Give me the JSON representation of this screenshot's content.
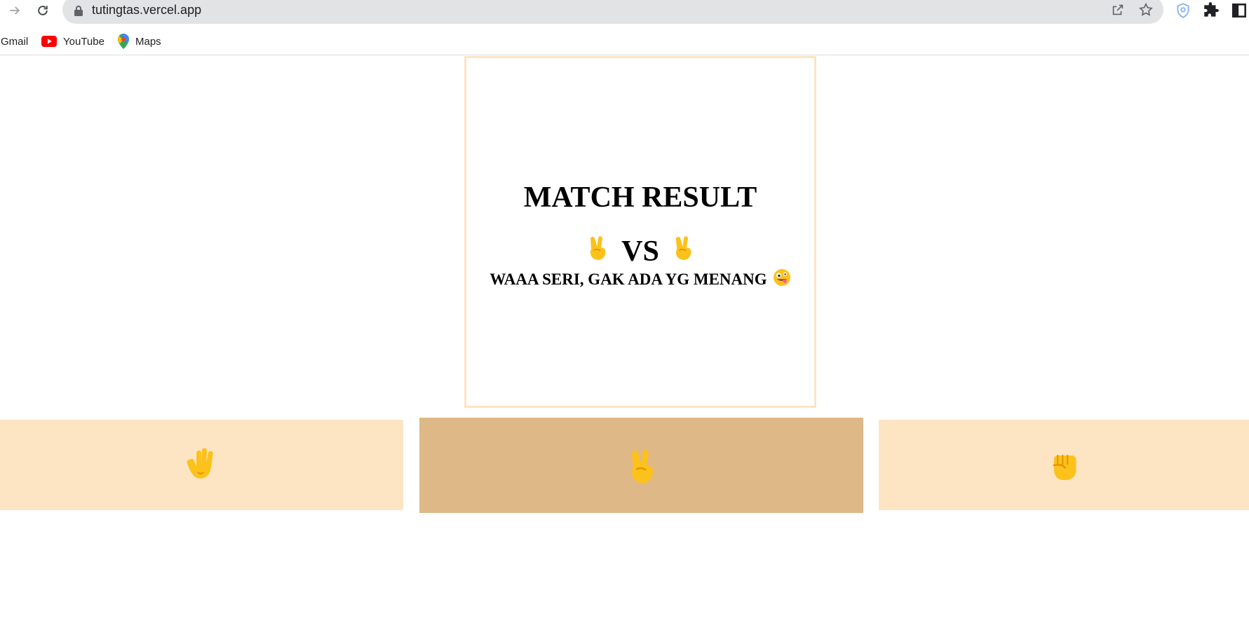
{
  "browser": {
    "url": "tutingtas.vercel.app",
    "bookmarks": [
      {
        "label": "Gmail",
        "icon": "gmail-icon"
      },
      {
        "label": "YouTube",
        "icon": "youtube-icon"
      },
      {
        "label": "Maps",
        "icon": "maps-icon"
      }
    ]
  },
  "game": {
    "title": "MATCH RESULT",
    "vs_label": "VS",
    "player_choice": "scissors",
    "computer_choice": "scissors",
    "message": "WAAA SERI, GAK ADA YG MENANG",
    "message_icon": "zany-face-icon",
    "choices": [
      {
        "name": "paper",
        "icon": "raised-hand-icon",
        "selected": false
      },
      {
        "name": "scissors",
        "icon": "victory-hand-icon",
        "selected": true
      },
      {
        "name": "rock",
        "icon": "raised-fist-icon",
        "selected": false
      }
    ]
  },
  "colors": {
    "choice_bg": "#fde4c3",
    "choice_selected_bg": "#deb887",
    "result_border": "#fde4c3"
  }
}
